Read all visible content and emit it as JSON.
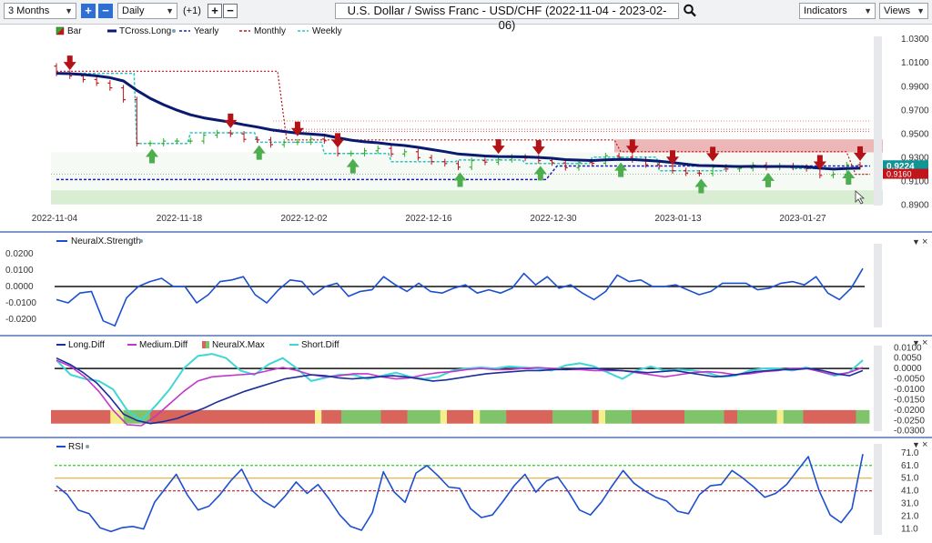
{
  "toolbar": {
    "period": "3 Months",
    "interval": "Daily",
    "offset": "(+1)",
    "title": "U.S. Dollar / Swiss Franc - USD/CHF (2022-11-04 - 2023-02-06)",
    "indicators": "Indicators",
    "views": "Views"
  },
  "chart_data": [
    {
      "type": "candlestick",
      "legend": [
        "Bar",
        "TCross.Long",
        "Yearly",
        "Monthly",
        "Weekly"
      ],
      "x_ticks": [
        "2022-11-04",
        "2022-11-18",
        "2022-12-02",
        "2022-12-16",
        "2022-12-30",
        "2023-01-13",
        "2023-01-27"
      ],
      "y_ticks": [
        "1.0300",
        "1.0100",
        "0.9900",
        "0.9700",
        "0.9500",
        "0.9300",
        "0.9100",
        "0.8900"
      ],
      "ylim": [
        0.888,
        1.034
      ],
      "current_price": "0.9224",
      "second_price_label": "0.9160",
      "colors": {
        "tcross": "#0a1a6e",
        "yearly": "#1d1fc2",
        "monthly": "#c0151a",
        "weekly": "#2fc3c3",
        "bull": "#2eaf2e",
        "bear": "#c0151a"
      },
      "close": [
        1.0013,
        0.999,
        0.996,
        0.993,
        0.989,
        0.979,
        0.942,
        0.942,
        0.944,
        0.944,
        0.944,
        0.949,
        0.951,
        0.95,
        0.9455,
        0.945,
        0.941,
        0.943,
        0.9432,
        0.9457,
        0.9443,
        0.9335,
        0.9335,
        0.9358,
        0.9378,
        0.9331,
        0.935,
        0.93,
        0.9266,
        0.925,
        0.922,
        0.9275,
        0.9262,
        0.9283,
        0.9305,
        0.9297,
        0.9275,
        0.9256,
        0.9215,
        0.9259,
        0.9253,
        0.9316,
        0.9304,
        0.9282,
        0.924,
        0.923,
        0.919,
        0.917,
        0.9167,
        0.922,
        0.9204,
        0.921,
        0.9237,
        0.9218,
        0.9231,
        0.9219,
        0.9207,
        0.915,
        0.916,
        0.924,
        0.9224
      ],
      "arrows_down": [
        1,
        13,
        18,
        21,
        33,
        36,
        43,
        46,
        49,
        57,
        62
      ],
      "arrows_up": [
        7,
        15,
        22,
        30,
        36,
        42,
        48,
        53,
        59
      ]
    },
    {
      "type": "line",
      "name": "NeuralX.Strength",
      "y_ticks": [
        "0.0200",
        "0.0100",
        "0.0000",
        "-0.0100",
        "-0.0200"
      ],
      "ylim": [
        -0.025,
        0.025
      ],
      "values": [
        -0.008,
        -0.01,
        -0.004,
        -0.003,
        -0.021,
        -0.024,
        -0.007,
        0.0,
        0.003,
        0.005,
        0.0,
        0.0,
        -0.01,
        -0.005,
        0.003,
        0.004,
        0.006,
        -0.005,
        -0.01,
        -0.002,
        0.004,
        0.003,
        -0.005,
        0.0,
        0.002,
        -0.006,
        -0.003,
        -0.002,
        0.006,
        0.001,
        -0.003,
        0.002,
        -0.003,
        -0.004,
        -0.001,
        0.001,
        -0.004,
        -0.002,
        -0.004,
        -0.001,
        0.008,
        0.001,
        0.006,
        -0.001,
        0.001,
        -0.004,
        -0.008,
        -0.003,
        0.007,
        0.003,
        0.004,
        0.0,
        0.0,
        0.001,
        -0.002,
        -0.005,
        -0.003,
        0.002,
        0.002,
        0.002,
        -0.002,
        -0.001,
        0.002,
        0.003,
        0.001,
        0.006,
        -0.004,
        -0.008,
        -0.001,
        0.011
      ]
    },
    {
      "type": "line",
      "legend": [
        "Long.Diff",
        "Medium.Diff",
        "NeuralX.Max",
        "Short.Diff"
      ],
      "y_ticks": [
        "0.0100",
        "0.0050",
        "0.0000",
        "-0.0050",
        "-0.0100",
        "-0.0150",
        "-0.0200",
        "-0.0250",
        "-0.0300"
      ],
      "ylim": [
        -0.031,
        0.011
      ],
      "long": [
        0.005,
        0.002,
        -0.002,
        -0.007,
        -0.014,
        -0.022,
        -0.025,
        -0.0265,
        -0.0255,
        -0.024,
        -0.0215,
        -0.019,
        -0.016,
        -0.0135,
        -0.011,
        -0.009,
        -0.007,
        -0.005,
        -0.004,
        -0.003,
        -0.0035,
        -0.0045,
        -0.005,
        -0.0045,
        -0.004,
        -0.0035,
        -0.004,
        -0.005,
        -0.006,
        -0.0055,
        -0.0045,
        -0.0035,
        -0.0025,
        -0.002,
        -0.0015,
        -0.001,
        -0.001,
        -0.0005,
        -0.0005,
        0.0,
        0.0,
        -0.0005,
        -0.001,
        -0.0015,
        -0.002,
        -0.0015,
        -0.001,
        -0.002,
        -0.003,
        -0.004,
        -0.0035,
        -0.0025,
        -0.0015,
        -0.001,
        -0.0005,
        -0.0005,
        0.0,
        -0.001,
        -0.0025,
        -0.0035,
        -0.001
      ],
      "medium": [
        0.004,
        0.001,
        -0.004,
        -0.011,
        -0.02,
        -0.027,
        -0.0275,
        -0.023,
        -0.017,
        -0.011,
        -0.006,
        -0.004,
        -0.0035,
        -0.003,
        -0.0025,
        -0.001,
        0.0005,
        -0.001,
        -0.003,
        -0.004,
        -0.0035,
        -0.0025,
        -0.0025,
        -0.004,
        -0.005,
        -0.0045,
        -0.003,
        -0.002,
        -0.0015,
        -0.0005,
        0.0,
        -0.0005,
        -0.0005,
        0.0,
        0.0005,
        0.0,
        -0.0005,
        -0.0005,
        -0.001,
        -0.001,
        -0.001,
        -0.002,
        -0.003,
        -0.004,
        -0.003,
        -0.002,
        -0.0015,
        -0.002,
        -0.003,
        -0.0025,
        -0.0015,
        -0.001,
        0.0,
        0.0,
        -0.0015,
        -0.003,
        -0.002,
        0.0005
      ],
      "short": [
        0.004,
        -0.003,
        -0.005,
        -0.006,
        -0.01,
        -0.02,
        -0.025,
        -0.018,
        -0.01,
        0.0,
        0.006,
        0.007,
        0.005,
        -0.001,
        -0.003,
        0.002,
        0.005,
        0.0,
        -0.006,
        -0.0045,
        -0.003,
        -0.003,
        -0.005,
        -0.0035,
        -0.002,
        -0.004,
        -0.005,
        -0.004,
        -0.001,
        0.0,
        0.0005,
        0.0,
        0.001,
        0.0005,
        0.0,
        -0.001,
        0.0015,
        0.0025,
        0.001,
        -0.002,
        -0.005,
        -0.001,
        0.001,
        -0.001,
        -0.0005,
        -0.001,
        -0.002,
        -0.004,
        -0.0035,
        -0.001,
        0.0,
        0.0,
        -0.001,
        0.0005,
        -0.0015,
        -0.0035,
        -0.002,
        0.004
      ],
      "neuralx_max": [
        "r",
        "r",
        "r",
        "r",
        "r",
        "r",
        "r",
        "r",
        "r",
        "y",
        "y",
        "g",
        "g",
        "g",
        "g",
        "r",
        "r",
        "r",
        "r",
        "r",
        "r",
        "r",
        "r",
        "r",
        "r",
        "r",
        "r",
        "r",
        "r",
        "r",
        "r",
        "r",
        "r",
        "r",
        "r",
        "r",
        "r",
        "r",
        "r",
        "r",
        "y",
        "r",
        "r",
        "r",
        "g",
        "g",
        "g",
        "g",
        "g",
        "g",
        "r",
        "r",
        "r",
        "r",
        "g",
        "g",
        "g",
        "g",
        "g",
        "y",
        "r",
        "r",
        "r",
        "r",
        "y",
        "g",
        "g",
        "g",
        "g",
        "r",
        "r",
        "r",
        "r",
        "r",
        "r",
        "r",
        "g",
        "g",
        "g",
        "g",
        "g",
        "g",
        "r",
        "y",
        "g",
        "g",
        "g",
        "g",
        "r",
        "r",
        "r",
        "r",
        "r",
        "r",
        "r",
        "r",
        "g",
        "g",
        "g",
        "g",
        "g",
        "g",
        "r",
        "r",
        "g",
        "g",
        "g",
        "g",
        "g",
        "g",
        "y",
        "g",
        "g",
        "g",
        "r",
        "r",
        "r",
        "r",
        "r",
        "r",
        "r",
        "r",
        "g",
        "g"
      ]
    },
    {
      "type": "line",
      "name": "RSI",
      "y_ticks": [
        "71.0",
        "61.0",
        "51.0",
        "41.0",
        "31.0",
        "21.0",
        "11.0"
      ],
      "ylim": [
        5,
        78
      ],
      "levels": {
        "upper": 61,
        "middle": 51,
        "lower": 41
      },
      "values": [
        45,
        38,
        26,
        23,
        12,
        9,
        12,
        13,
        11,
        32,
        43,
        54,
        38,
        26,
        29,
        38,
        49,
        58,
        41,
        33,
        28,
        37,
        48,
        39,
        46,
        35,
        22,
        13,
        10,
        24,
        56,
        40,
        32,
        55,
        61,
        53,
        44,
        43,
        27,
        20,
        22,
        33,
        45,
        54,
        40,
        49,
        52,
        40,
        26,
        22,
        32,
        45,
        57,
        47,
        41,
        36,
        33,
        25,
        23,
        38,
        45,
        46,
        57,
        51,
        44,
        36,
        39,
        46,
        57,
        68,
        41,
        22,
        16,
        27,
        70
      ]
    }
  ]
}
